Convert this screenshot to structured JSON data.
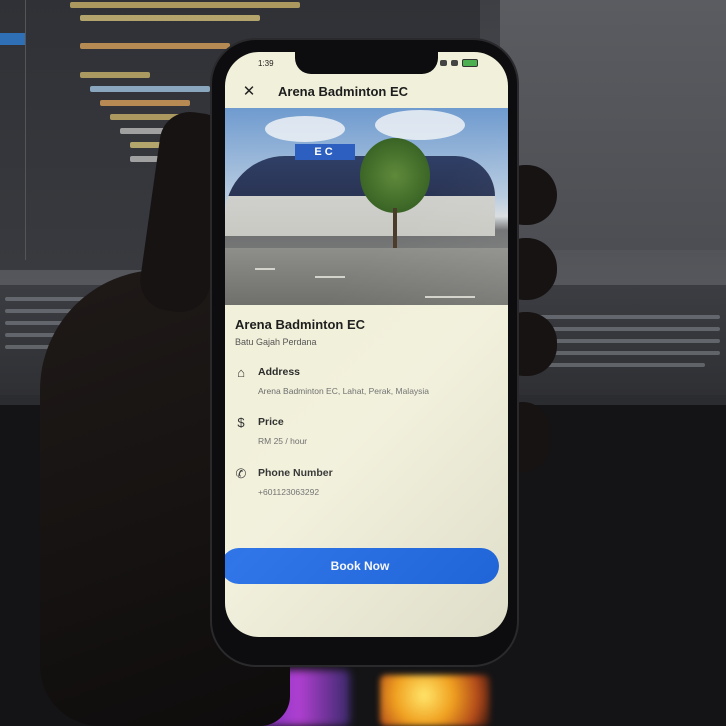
{
  "status_bar": {
    "time": "1:39"
  },
  "app_bar": {
    "close_icon": "close-icon",
    "title": "Arena Badminton EC"
  },
  "photo": {
    "sign_text": "EC"
  },
  "venue": {
    "name": "Arena Badminton EC",
    "location": "Batu Gajah Perdana"
  },
  "details": [
    {
      "icon": "home-icon",
      "label": "Address",
      "value": "Arena Badminton EC, Lahat, Perak, Malaysia"
    },
    {
      "icon": "dollar-icon",
      "label": "Price",
      "value": "RM 25 / hour"
    },
    {
      "icon": "phone-icon",
      "label": "Phone Number",
      "value": "+601123063292"
    }
  ],
  "actions": {
    "book_label": "Book Now"
  },
  "colors": {
    "accent": "#1f6ae6",
    "screen_bg": "#f1f0da"
  }
}
